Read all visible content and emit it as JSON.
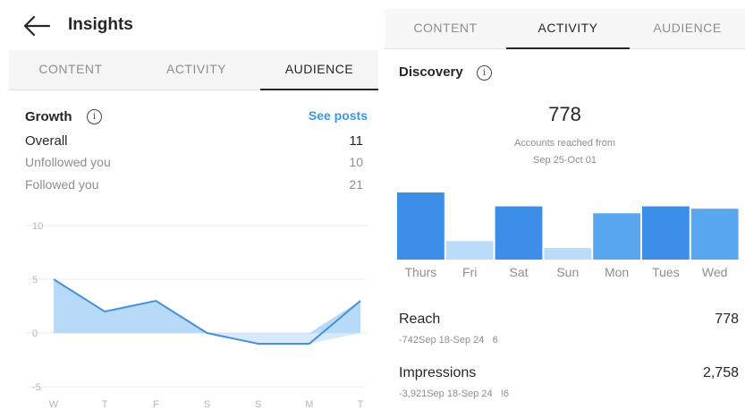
{
  "left": {
    "header": {
      "title": "Insights",
      "back_icon": "arrow-left-icon"
    },
    "tabs": [
      {
        "label": "CONTENT",
        "active": false
      },
      {
        "label": "ACTIVITY",
        "active": false
      },
      {
        "label": "AUDIENCE",
        "active": true
      }
    ],
    "growth": {
      "title": "Growth",
      "see_posts": "See posts",
      "rows": [
        {
          "label": "Overall",
          "value": "11"
        },
        {
          "label": "Unfollowed you",
          "value": "10"
        },
        {
          "label": "Followed you",
          "value": "21"
        }
      ]
    }
  },
  "right": {
    "tabs": [
      {
        "label": "CONTENT",
        "active": false
      },
      {
        "label": "ACTIVITY",
        "active": true
      },
      {
        "label": "AUDIENCE",
        "active": false
      }
    ],
    "discovery": {
      "title": "Discovery",
      "accounts_reached": "778",
      "caption_line1": "Accounts reached from",
      "caption_line2": "Sep 25-Oct 01"
    },
    "metrics": [
      {
        "name": "Reach",
        "value": "778",
        "delta": "-742",
        "period": "Sep 18-Sep 24",
        "tail": "6"
      },
      {
        "name": "Impressions",
        "value": "2,758",
        "delta": "-3,921",
        "period": "Sep 18-Sep 24",
        "tail": "!6"
      }
    ]
  },
  "colors": {
    "accent_blue": "#3897f0",
    "bar_dark": "#3d8ee6",
    "bar_mid": "#59a7ef",
    "bar_light": "#b9dcfa",
    "area_fill": "#a9d3f6",
    "line": "#4a90d9"
  },
  "chart_data": [
    {
      "type": "area",
      "title": "",
      "categories": [
        "W",
        "T",
        "F",
        "S",
        "S",
        "M",
        "T"
      ],
      "series": [
        {
          "values": [
            5,
            2,
            3,
            0,
            -1,
            -1,
            3
          ]
        }
      ],
      "yticks": [
        "10",
        "5",
        "0",
        "-5"
      ],
      "ylim": [
        -5,
        10
      ],
      "grid": true
    },
    {
      "type": "bar",
      "title": "",
      "categories": [
        "Thurs",
        "Fri",
        "Sat",
        "Sun",
        "Mon",
        "Tues",
        "Wed"
      ],
      "values": [
        145,
        40,
        115,
        25,
        100,
        115,
        110
      ],
      "shade": [
        "dark",
        "light",
        "dark",
        "light",
        "mid",
        "dark",
        "mid"
      ]
    }
  ]
}
